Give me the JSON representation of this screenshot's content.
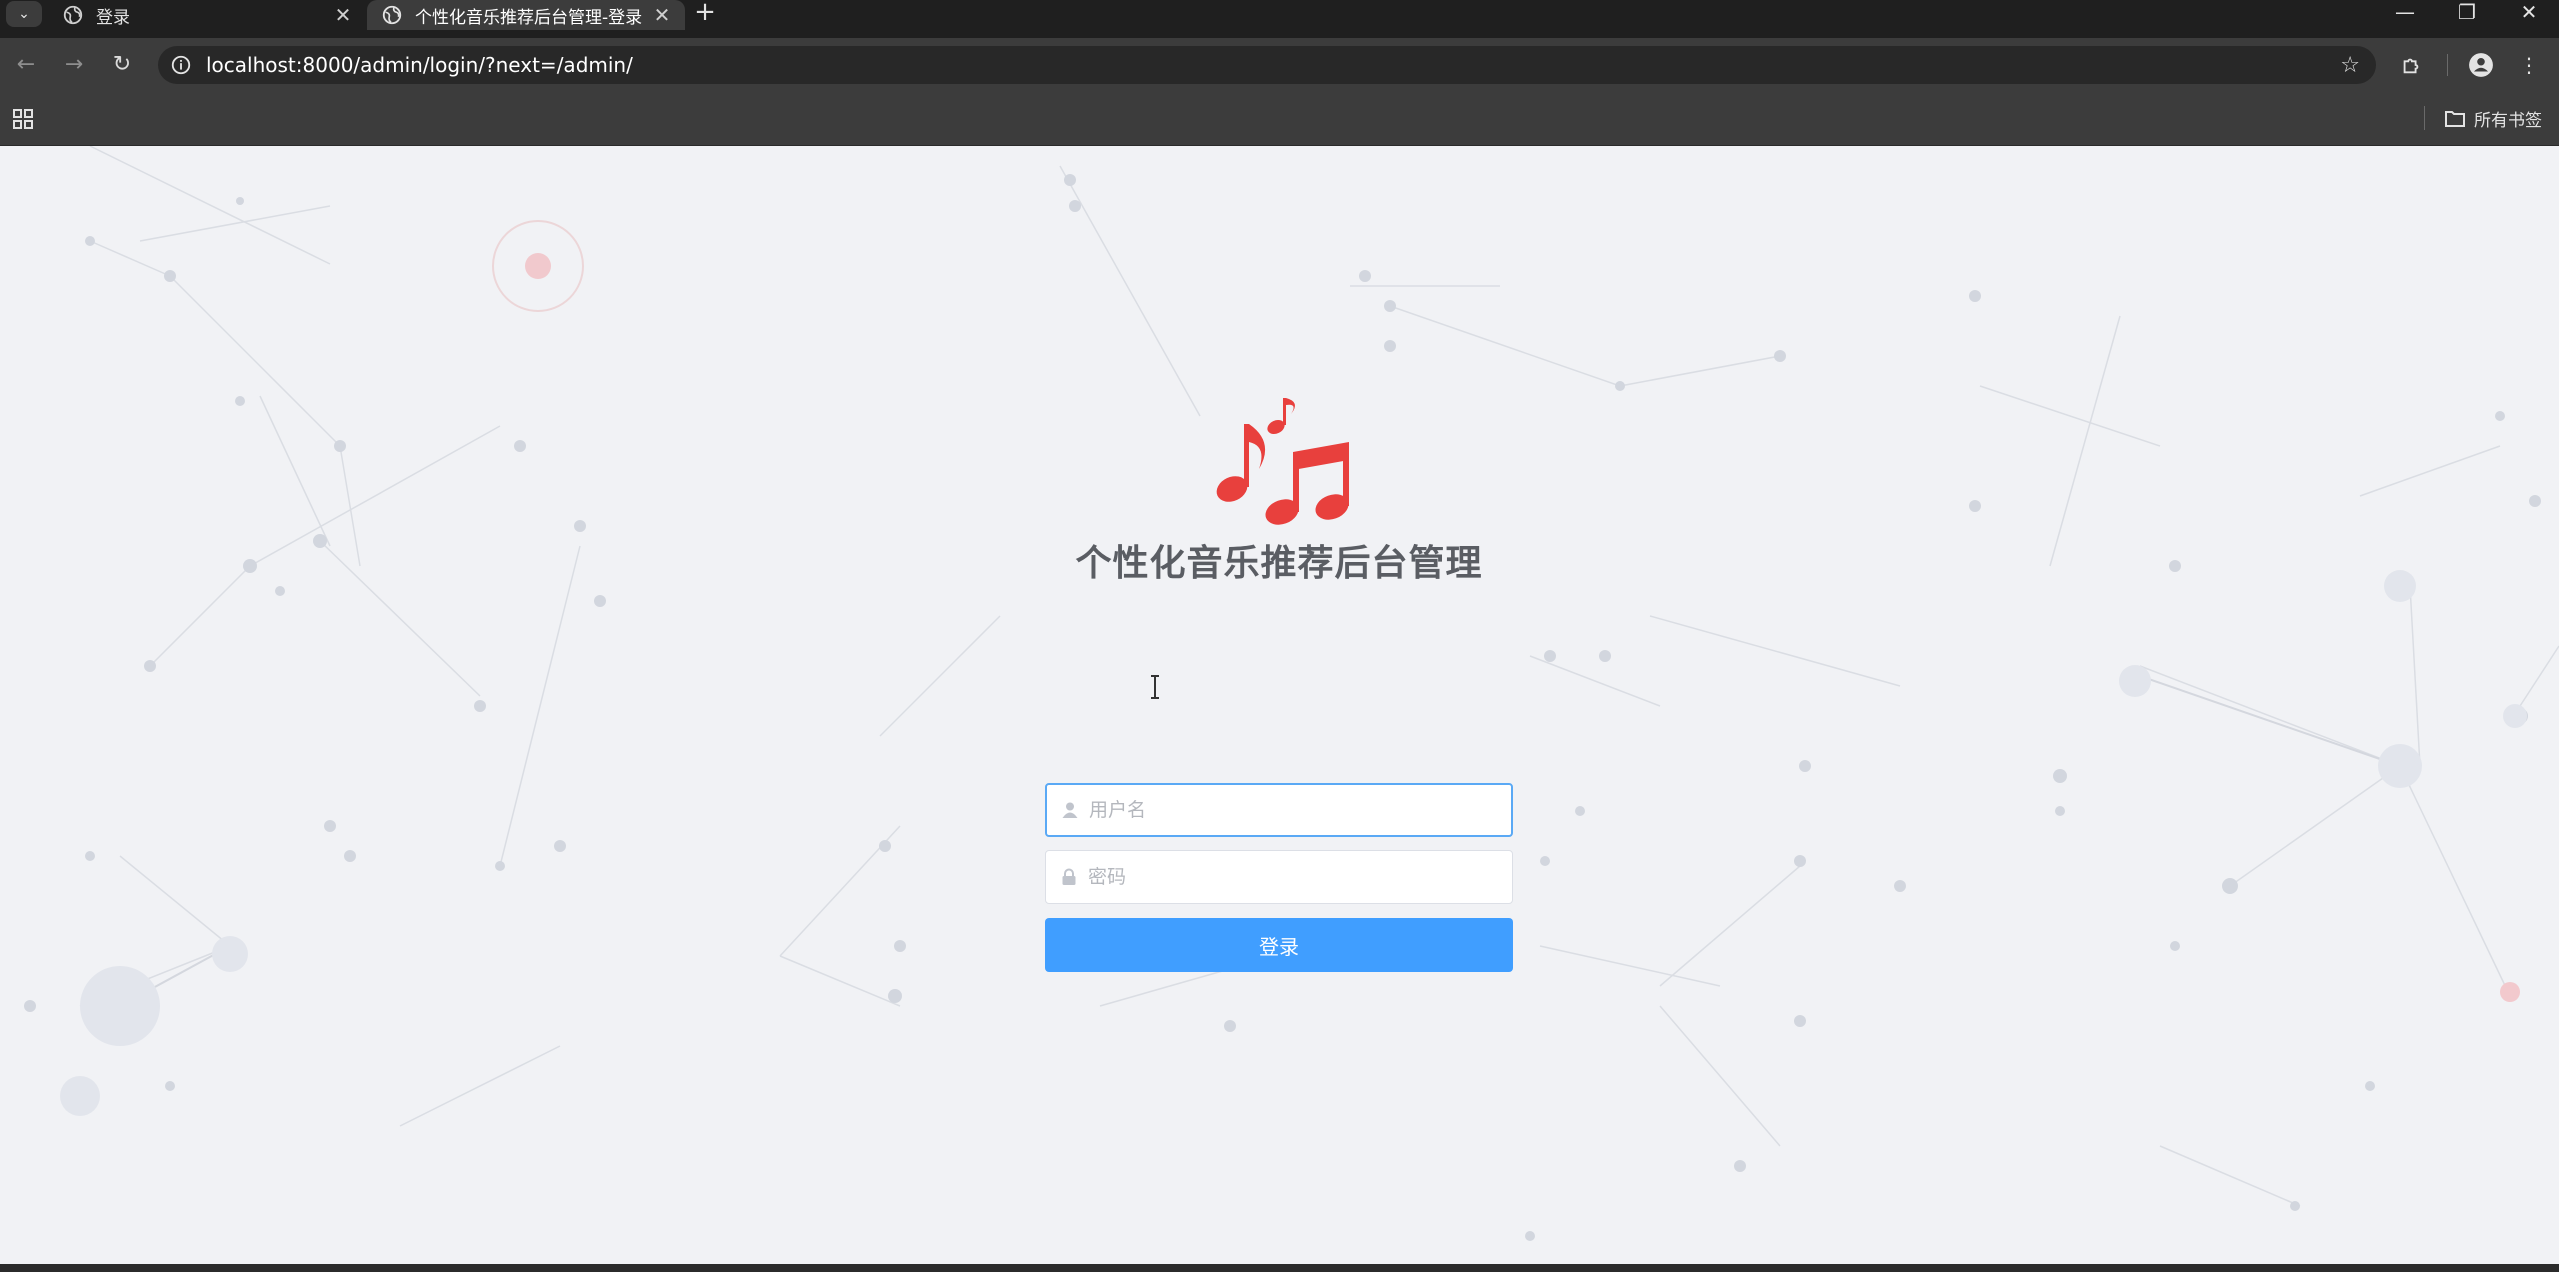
{
  "browser": {
    "tabs": [
      {
        "label": "登录",
        "close": "✕"
      },
      {
        "label": "个性化音乐推荐后台管理-登录",
        "close": "✕"
      }
    ],
    "new_tab": "+",
    "url": "localhost:8000/admin/login/?next=/admin/",
    "all_bookmarks": "所有书签",
    "window_controls": {
      "minimize": "—",
      "restore": "❐",
      "close": "✕"
    }
  },
  "login": {
    "title": "个性化音乐推荐后台管理",
    "username_placeholder": "用户名",
    "password_placeholder": "密码",
    "submit_label": "登录"
  },
  "colors": {
    "primary": "#409eff",
    "logo": "#e8403d",
    "focus_border": "#5aa9f5"
  }
}
